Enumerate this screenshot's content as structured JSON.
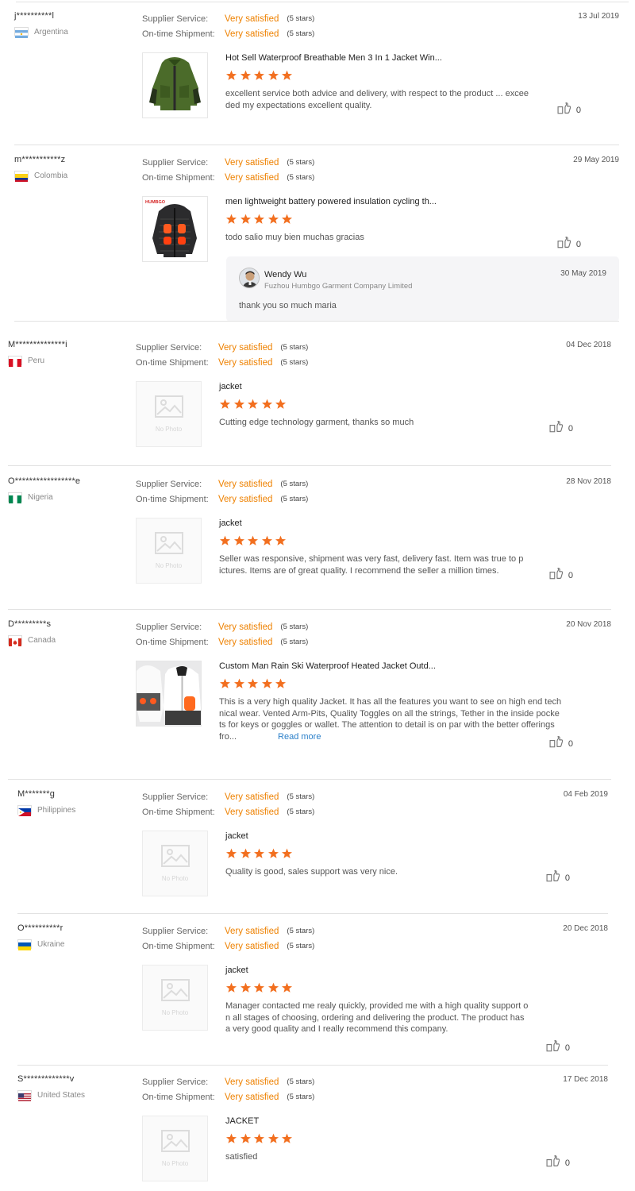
{
  "labels": {
    "supplier_service": "Supplier Service:",
    "ontime_shipment": "On-time Shipment:",
    "no_photo": "No Photo",
    "read_more": "Read more"
  },
  "colors": {
    "accent": "#ee8100",
    "star": "#f26f1f",
    "link": "#2a7fc9"
  },
  "reviews": [
    {
      "buyer": "j**********l",
      "country": "Argentina",
      "flag_icon": "argentina-flag-icon",
      "supplier_service": "Very satisfied",
      "supplier_service_stars": "(5 stars)",
      "ontime_shipment": "Very satisfied",
      "ontime_shipment_stars": "(5 stars)",
      "date": "13 Jul 2019",
      "product_title": "Hot Sell Waterproof Breathable Men 3 In 1 Jacket Win...",
      "product_rating": 5,
      "feedback": [
        "excellent service both advice and delivery, with respect to the product ... excee",
        "ded my expectations excellent quality."
      ],
      "likes": "0",
      "image": "green-jacket-photo"
    },
    {
      "buyer": "m***********z",
      "country": "Colombia",
      "flag_icon": "colombia-flag-icon",
      "supplier_service": "Very satisfied",
      "supplier_service_stars": "(5 stars)",
      "ontime_shipment": "Very satisfied",
      "ontime_shipment_stars": "(5 stars)",
      "date": "29 May 2019",
      "product_title": "men lightweight battery powered insulation cycling th...",
      "product_rating": 5,
      "feedback": [
        "todo salio muy bien muchas gracias"
      ],
      "likes": "0",
      "image": "heated-jacket-photo",
      "image_brand": "HUMBGO",
      "reply": {
        "name": "Wendy Wu",
        "company": "Fuzhou Humbgo Garment Company Limited",
        "date": "30 May 2019",
        "text": "thank you so much maria"
      }
    },
    {
      "buyer": "M**************i",
      "country": "Peru",
      "flag_icon": "peru-flag-icon",
      "supplier_service": "Very satisfied",
      "supplier_service_stars": "(5 stars)",
      "ontime_shipment": "Very satisfied",
      "ontime_shipment_stars": "(5 stars)",
      "date": "04 Dec 2018",
      "product_title": "jacket",
      "product_rating": 5,
      "feedback": [
        "Cutting edge technology garment, thanks so much"
      ],
      "likes": "0",
      "image": "no-photo"
    },
    {
      "buyer": "O*****************e",
      "country": "Nigeria",
      "flag_icon": "nigeria-flag-icon",
      "supplier_service": "Very satisfied",
      "supplier_service_stars": "(5 stars)",
      "ontime_shipment": "Very satisfied",
      "ontime_shipment_stars": "(5 stars)",
      "date": "28 Nov 2018",
      "product_title": "jacket",
      "product_rating": 5,
      "feedback": [
        "Seller was responsive, shipment was very fast, delivery fast. Item was true to p",
        "ictures. Items are of great quality. I recommend the seller a million times."
      ],
      "likes": "0",
      "image": "no-photo"
    },
    {
      "buyer": "D*********s",
      "country": "Canada",
      "flag_icon": "canada-flag-icon",
      "supplier_service": "Very satisfied",
      "supplier_service_stars": "(5 stars)",
      "ontime_shipment": "Very satisfied",
      "ontime_shipment_stars": "(5 stars)",
      "date": "20 Nov 2018",
      "product_title": "Custom Man Rain Ski Waterproof Heated Jacket Outd...",
      "product_rating": 5,
      "feedback": [
        "This is a very high quality Jacket. It has all the features you want to see on high end tech",
        "nical wear. Vented Arm-Pits, Quality Toggles on all the strings, Tether in the inside pocke",
        "ts for keys or goggles or wallet. The attention to detail is on par with the better offerings",
        "fro..."
      ],
      "read_more": true,
      "likes": "0",
      "image": "ski-jacket-photo"
    },
    {
      "buyer": "M*******g",
      "country": "Philippines",
      "flag_icon": "philippines-flag-icon",
      "supplier_service": "Very satisfied",
      "supplier_service_stars": "(5 stars)",
      "ontime_shipment": "Very satisfied",
      "ontime_shipment_stars": "(5 stars)",
      "date": "04 Feb 2019",
      "product_title": "jacket",
      "product_rating": 5,
      "feedback": [
        "Quality is good, sales support was very nice."
      ],
      "likes": "0",
      "image": "no-photo"
    },
    {
      "buyer": "O**********r",
      "country": "Ukraine",
      "flag_icon": "ukraine-flag-icon",
      "supplier_service": "Very satisfied",
      "supplier_service_stars": "(5 stars)",
      "ontime_shipment": "Very satisfied",
      "ontime_shipment_stars": "(5 stars)",
      "date": "20 Dec 2018",
      "product_title": "jacket",
      "product_rating": 5,
      "feedback": [
        "Manager contacted me realy quickly, provided me with a high quality support o",
        "n all stages of choosing, ordering and delivering the product. The product has",
        "a very good quality and I really recommend this company."
      ],
      "likes": "0",
      "image": "no-photo"
    },
    {
      "buyer": "S*************v",
      "country": "United States",
      "flag_icon": "usa-flag-icon",
      "supplier_service": "Very satisfied",
      "supplier_service_stars": "(5 stars)",
      "ontime_shipment": "Very satisfied",
      "ontime_shipment_stars": "(5 stars)",
      "date": "17 Dec 2018",
      "product_title": "JACKET",
      "product_rating": 5,
      "feedback": [
        "satisfied"
      ],
      "likes": "0",
      "image": "no-photo"
    }
  ]
}
